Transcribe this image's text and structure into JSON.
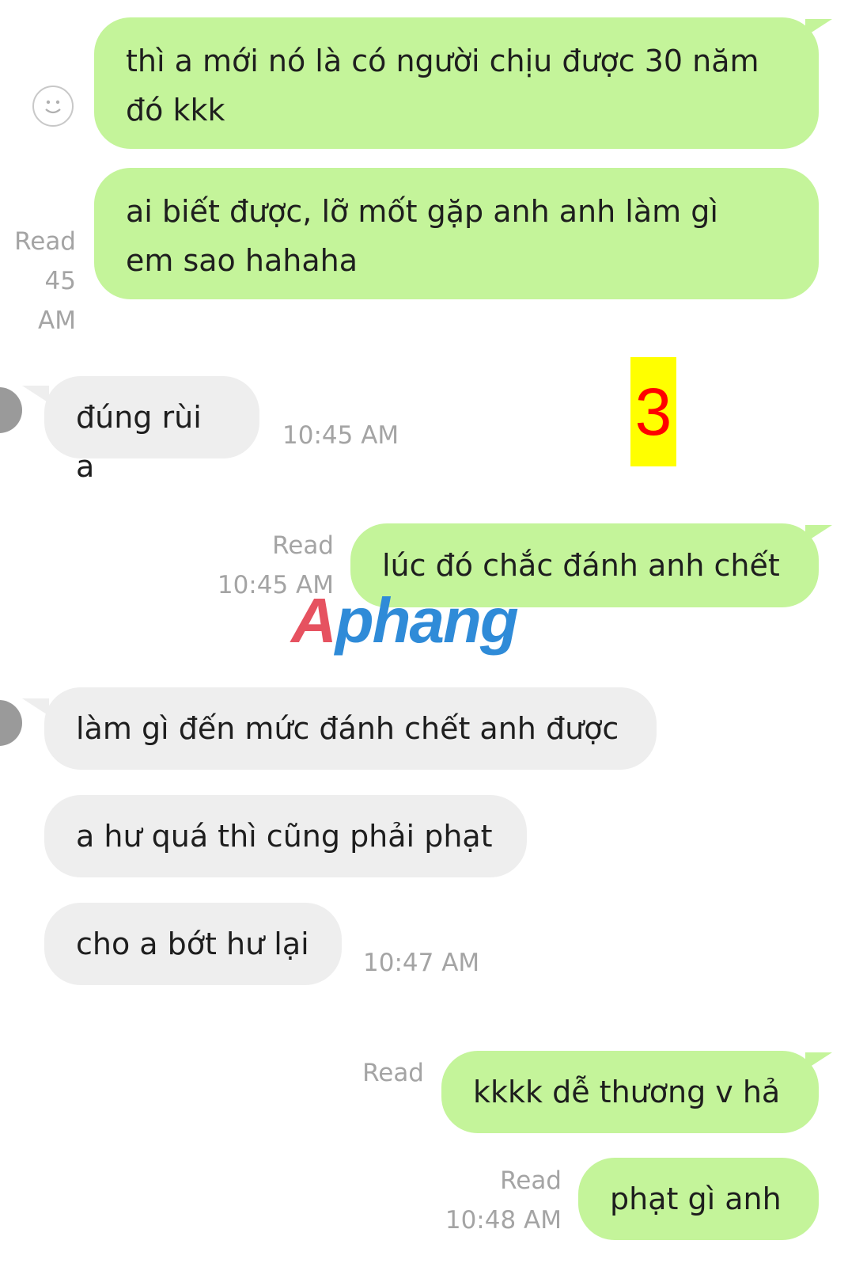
{
  "messages": [
    {
      "id": 1,
      "sender": "me",
      "lines": [
        "thì a mới nó là có người chịu được 30 năm",
        "đó kkk"
      ]
    },
    {
      "id": 2,
      "sender": "me",
      "lines": [
        "ai biết được, lỡ mốt gặp anh anh làm gì",
        "em sao hahaha"
      ],
      "status": "Read",
      "time_partial": "45 AM"
    },
    {
      "id": 3,
      "sender": "them",
      "text": "đúng rùi a",
      "time": "10:45 AM"
    },
    {
      "id": 4,
      "sender": "me",
      "text": "lúc đó chắc đánh anh chết",
      "status": "Read",
      "time": "10:45 AM"
    },
    {
      "id": 5,
      "sender": "them",
      "text": "làm gì đến mức đánh chết anh được"
    },
    {
      "id": 6,
      "sender": "them",
      "text": "a hư quá thì cũng phải phạt"
    },
    {
      "id": 7,
      "sender": "them",
      "text": "cho a bớt hư lại",
      "time": "10:47 AM"
    },
    {
      "id": 8,
      "sender": "me",
      "text": "kkkk dễ thương v hả",
      "status": "Read"
    },
    {
      "id": 9,
      "sender": "me",
      "text": "phạt gì anh",
      "status": "Read",
      "time": "10:48 AM"
    }
  ],
  "overlay": {
    "badge_number": "3",
    "watermark_part1": "A",
    "watermark_part2": "phang"
  },
  "colors": {
    "outgoing_bubble": "#c4f49a",
    "incoming_bubble": "#eeeeee",
    "meta_text": "#a4a4a4",
    "badge_bg": "#ffff00",
    "badge_text": "#ff0000"
  }
}
